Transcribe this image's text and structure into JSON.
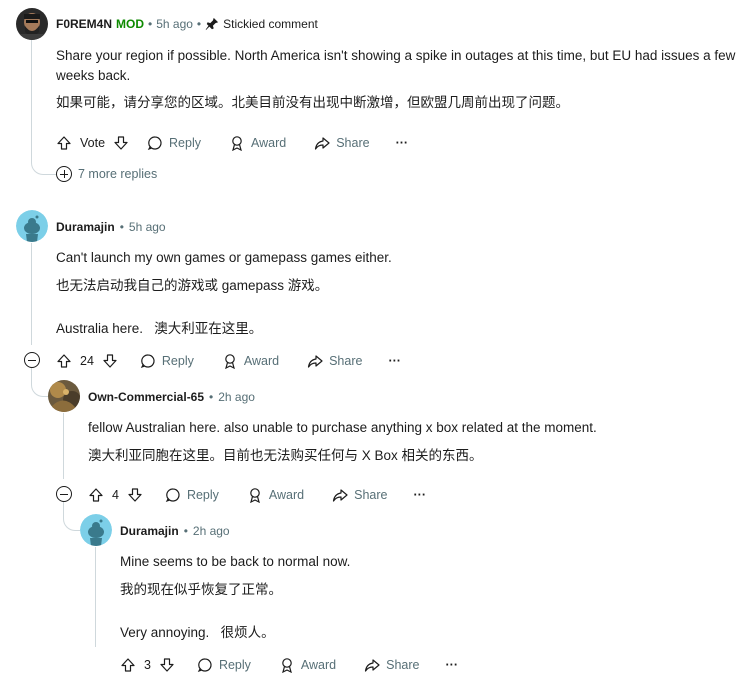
{
  "comments": [
    {
      "author": "F0REM4N",
      "badge": "MOD",
      "time": "5h ago",
      "stickied": "Stickied comment",
      "lines": [
        "Share your region if possible. North America isn't showing a spike in outages at this time, but EU had issues a few weeks back.",
        "如果可能，请分享您的区域。北美目前没有出现中断激增，但欧盟几周前出现了问题。"
      ],
      "vote": "Vote",
      "more_replies": "7 more replies"
    },
    {
      "author": "Duramajin",
      "time": "5h ago",
      "lines": [
        "Can't launch my own games or gamepass games either.",
        "也无法启动我自己的游戏或 gamepass 游戏。",
        "Australia here.   澳大利亚在这里。"
      ],
      "vote": "24"
    },
    {
      "author": "Own-Commercial-65",
      "time": "2h ago",
      "lines": [
        "fellow Australian here. also unable to purchase anything x box related at the moment.",
        "澳大利亚同胞在这里。目前也无法购买任何与 X Box 相关的东西。"
      ],
      "vote": "4"
    },
    {
      "author": "Duramajin",
      "time": "2h ago",
      "lines": [
        "Mine seems to be back to normal now.",
        "我的现在似乎恢复了正常。",
        "Very annoying.   很烦人。"
      ],
      "vote": "3"
    }
  ],
  "actions": {
    "reply": "Reply",
    "award": "Award",
    "share": "Share",
    "more": "···"
  },
  "colors": {
    "meta": "#576f76",
    "mod": "#0e8a00",
    "thread_line": "#cfd8dc",
    "snoo": "#7ccfe8"
  }
}
